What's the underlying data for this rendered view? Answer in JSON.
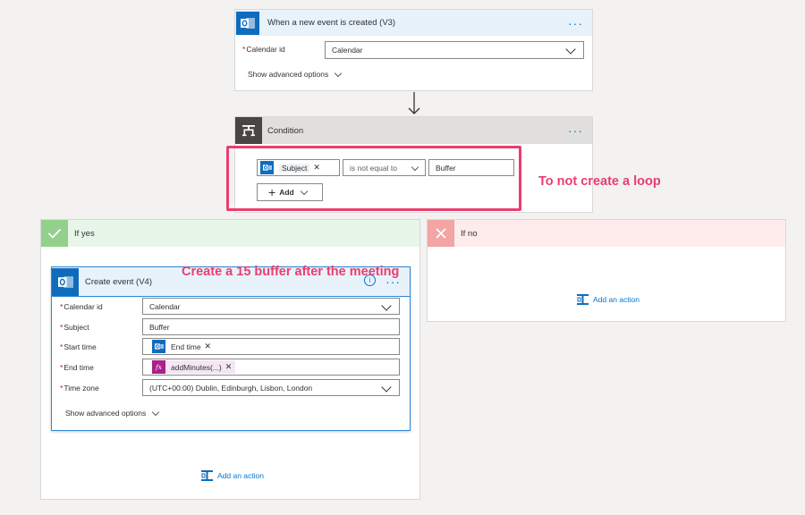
{
  "trigger": {
    "title": "When a new event is created (V3)",
    "calendar_label": "Calendar id",
    "calendar_value": "Calendar",
    "advanced": "Show advanced options"
  },
  "condition": {
    "title": "Condition",
    "token_label": "Subject",
    "operator": "is not equal to",
    "value": "Buffer",
    "add_label": "Add"
  },
  "annotations": {
    "loop": "To not create a loop",
    "buffer": "Create a 15 buffer after the meeting"
  },
  "if_yes": {
    "title": "If yes",
    "add_action": "Add an action"
  },
  "if_no": {
    "title": "If no",
    "add_action": "Add an action"
  },
  "create_event": {
    "title": "Create event (V4)",
    "advanced": "Show advanced options",
    "fields": {
      "calendar": {
        "label": "Calendar id",
        "value": "Calendar"
      },
      "subject": {
        "label": "Subject",
        "value": "Buffer"
      },
      "start": {
        "label": "Start time",
        "token": "End time"
      },
      "end": {
        "label": "End time",
        "token": "addMinutes(...)",
        "token_icon": "fx"
      },
      "timezone": {
        "label": "Time zone",
        "value": "(UTC+00:00) Dublin, Edinburgh, Lisbon, London"
      }
    }
  },
  "colors": {
    "accent": "#0078d4",
    "outlook": "#0f6cbd",
    "annotation": "#e83e6e",
    "yes_header": "#e8f5e9",
    "yes_tile": "#92d08c",
    "no_header": "#fdeceb",
    "no_tile": "#f2a5a3",
    "condition_header": "#e1dfdd",
    "condition_tile": "#484644"
  },
  "icons": [
    "outlook-icon",
    "condition-icon",
    "check-icon",
    "x-icon",
    "add-action-icon",
    "info-icon",
    "fx-icon",
    "ellipsis-icon"
  ]
}
